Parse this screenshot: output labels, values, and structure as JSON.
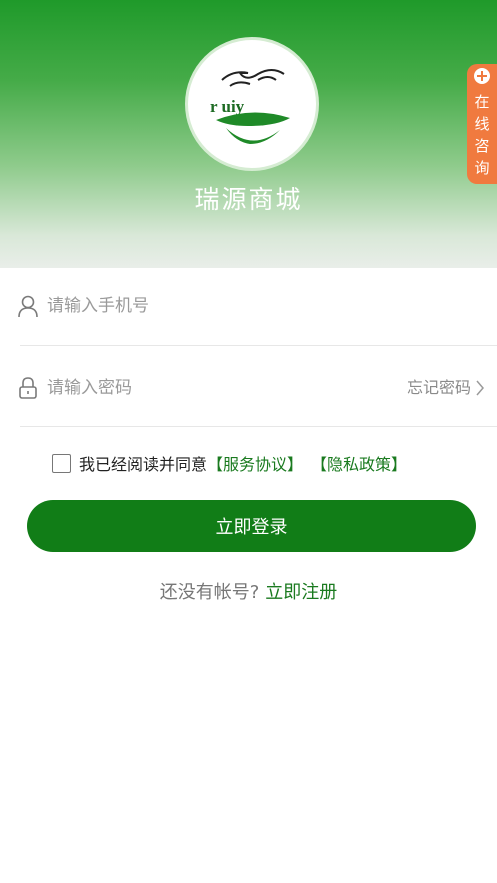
{
  "header": {
    "logo_text": "r uiy",
    "app_name": "瑞源商城"
  },
  "consult": {
    "label": "在线咨询"
  },
  "form": {
    "phone_placeholder": "请输入手机号",
    "password_placeholder": "请输入密码",
    "forgot_label": "忘记密码"
  },
  "agreement": {
    "prefix": "我已经阅读并同意",
    "service_link": "【服务协议】",
    "privacy_link": "【隐私政策】"
  },
  "login": {
    "button_label": "立即登录"
  },
  "register": {
    "prompt": "还没有帐号?",
    "link": "立即注册"
  },
  "colors": {
    "brand_green": "#117d17",
    "link_green": "#1a7a1f",
    "consult_orange": "#f07a3f"
  }
}
